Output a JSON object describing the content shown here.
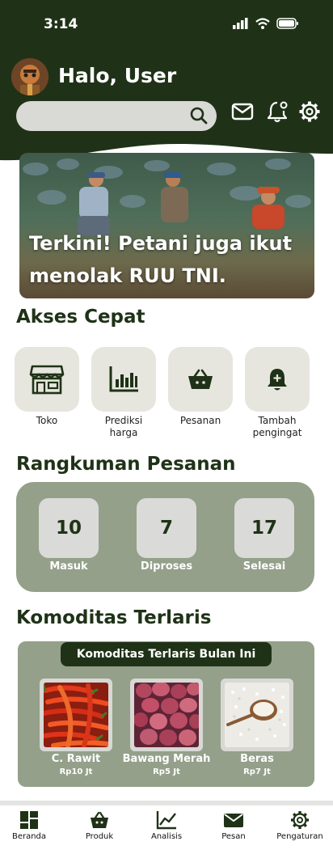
{
  "status_bar": {
    "time": "3:14"
  },
  "header": {
    "greeting": "Halo, User",
    "search": {
      "placeholder": ""
    }
  },
  "banner": {
    "title": "Terkini! Petani juga ikut menolak RUU TNI."
  },
  "quick_access": {
    "title": "Akses Cepat",
    "items": [
      {
        "label": "Toko",
        "icon": "store-icon"
      },
      {
        "label": "Prediksi harga",
        "icon": "bar-chart-icon"
      },
      {
        "label": "Pesanan",
        "icon": "basket-icon"
      },
      {
        "label": "Tambah pengingat",
        "icon": "bell-plus-icon"
      }
    ]
  },
  "order_summary": {
    "title": "Rangkuman Pesanan",
    "items": [
      {
        "count": "10",
        "label": "Masuk"
      },
      {
        "count": "7",
        "label": "Diproses"
      },
      {
        "count": "17",
        "label": "Selesai"
      }
    ]
  },
  "commodities": {
    "title": "Komoditas Terlaris",
    "subtitle": "Komoditas Terlaris Bulan Ini",
    "items": [
      {
        "name": "C. Rawit",
        "price": "Rp10 Jt"
      },
      {
        "name": "Bawang Merah",
        "price": "Rp5 Jt"
      },
      {
        "name": "Beras",
        "price": "Rp7 Jt"
      }
    ]
  },
  "bottom_nav": [
    {
      "label": "Beranda",
      "icon": "home-grid-icon"
    },
    {
      "label": "Produk",
      "icon": "basket-icon"
    },
    {
      "label": "Analisis",
      "icon": "analytics-icon"
    },
    {
      "label": "Pesan",
      "icon": "mail-icon"
    },
    {
      "label": "Pengaturan",
      "icon": "gear-icon"
    }
  ],
  "colors": {
    "primary": "#1f3217",
    "panel": "#94a08a",
    "tile": "#e6e6de"
  }
}
